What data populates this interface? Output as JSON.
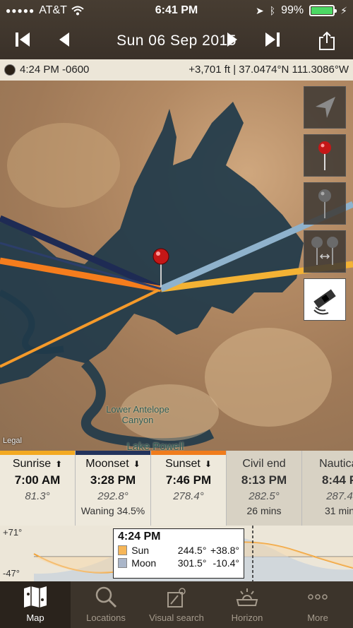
{
  "status": {
    "carrier": "AT&T",
    "time": "6:41 PM",
    "battery": "99%"
  },
  "header": {
    "date": "Sun 06 Sep 2015"
  },
  "info": {
    "time_tz": "4:24 PM -0600",
    "location": "+3,701 ft | 37.0474°N 111.3086°W"
  },
  "map": {
    "place_label": "Lower Antelope Canyon",
    "lake_label": "Lake Powell",
    "legal": "Legal"
  },
  "events": [
    {
      "title": "Sunrise",
      "arrow": "up",
      "time": "7:00 AM",
      "az": "81.3°",
      "extra": "",
      "color": "#f3a921",
      "dim": false
    },
    {
      "title": "Moonset",
      "arrow": "down",
      "time": "3:28 PM",
      "az": "292.8°",
      "extra": "Waning 34.5%",
      "color": "#23335c",
      "dim": false
    },
    {
      "title": "Sunset",
      "arrow": "down",
      "time": "7:46 PM",
      "az": "278.4°",
      "extra": "",
      "color": "#f07c1c",
      "dim": false
    },
    {
      "title": "Civil end",
      "arrow": "",
      "time": "8:13 PM",
      "az": "282.5°",
      "extra": "26 mins",
      "color": "",
      "dim": true
    },
    {
      "title": "Nautical",
      "arrow": "",
      "time": "8:44 P",
      "az": "287.4",
      "extra": "31 min",
      "color": "",
      "dim": true
    }
  ],
  "graph": {
    "top_label": "+71°",
    "bottom_label": "-47°",
    "tooltip": {
      "time": "4:24 PM",
      "sun": {
        "name": "Sun",
        "az": "244.5°",
        "alt": "+38.8°",
        "color": "#f6b658"
      },
      "moon": {
        "name": "Moon",
        "az": "301.5°",
        "alt": "-10.4°",
        "color": "#aab6c9"
      }
    }
  },
  "tabs": [
    {
      "label": "Map",
      "icon": "map-icon",
      "active": true
    },
    {
      "label": "Locations",
      "icon": "search-icon",
      "active": false
    },
    {
      "label": "Visual search",
      "icon": "visual-search-icon",
      "active": false
    },
    {
      "label": "Horizon",
      "icon": "horizon-icon",
      "active": false
    },
    {
      "label": "More",
      "icon": "more-icon",
      "active": false
    }
  ]
}
